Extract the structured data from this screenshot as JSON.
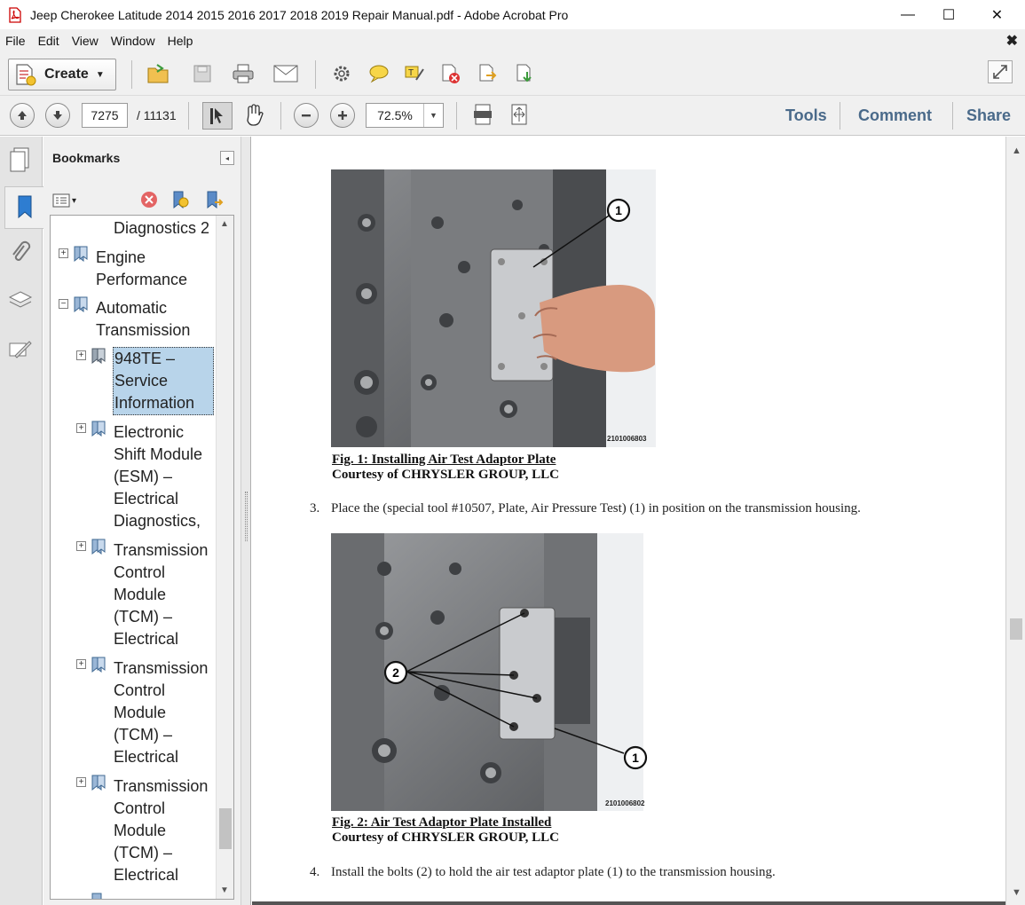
{
  "window": {
    "title": "Jeep Cherokee Latitude 2014 2015 2016 2017 2018 2019 Repair Manual.pdf - Adobe Acrobat Pro",
    "minimize": "—",
    "maximize": "☐",
    "close": "✕"
  },
  "menu": {
    "items": [
      "File",
      "Edit",
      "View",
      "Window",
      "Help"
    ],
    "close": "✖"
  },
  "toolbar": {
    "create_label": "Create",
    "create_caret": "▼"
  },
  "nav": {
    "current_page": "7275",
    "total_pages": "/  11131",
    "zoom": "72.5%",
    "zoom_caret": "▼",
    "tools": "Tools",
    "comment": "Comment",
    "share": "Share"
  },
  "bookmarks": {
    "header": "Bookmarks",
    "collapse": "◂",
    "options_caret": "▾",
    "nodes": [
      {
        "label": "Diagnostics 2"
      },
      {
        "label": "Engine Performance",
        "expander": "+"
      },
      {
        "label": "Automatic Transmission",
        "expander": "−"
      },
      {
        "label": "948TE – Service Information",
        "expander": "+",
        "selected": true
      },
      {
        "label": "Electronic Shift Module (ESM) – Electrical Diagnostics,",
        "expander": "+"
      },
      {
        "label": "Transmission Control Module (TCM) – Electrical",
        "expander": "+"
      },
      {
        "label": "Transmission Control Module (TCM) – Electrical",
        "expander": "+"
      },
      {
        "label": "Transmission Control Module (TCM) – Electrical",
        "expander": "+"
      }
    ]
  },
  "document": {
    "fig1": {
      "title": "Fig. 1: Installing Air Test Adaptor Plate",
      "courtesy": "Courtesy of CHRYSLER GROUP, LLC",
      "code": "2101006803",
      "callout": "1"
    },
    "step3": {
      "num": "3.",
      "text": "Place the (special tool #10507, Plate, Air Pressure Test) (1) in position on the transmission housing."
    },
    "fig2": {
      "title": "Fig. 2: Air Test Adaptor Plate Installed",
      "courtesy": "Courtesy of CHRYSLER GROUP, LLC",
      "code": "2101006802",
      "callout_1": "1",
      "callout_2": "2"
    },
    "step4": {
      "num": "4.",
      "text": "Install the bolts (2) to hold the air test adaptor plate (1) to the transmission housing."
    }
  },
  "colors": {
    "chrome": "#f0f0f0",
    "selected": "#b8d4ea",
    "link": "#4a6a8a"
  }
}
